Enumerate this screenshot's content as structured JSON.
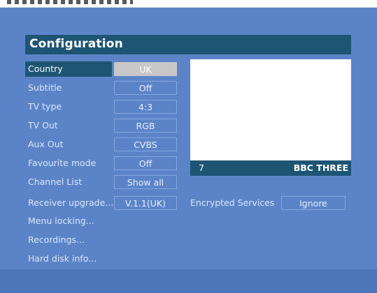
{
  "menu_title": "Configuration",
  "settings": [
    {
      "label": "Country",
      "value": "UK"
    },
    {
      "label": "Subtitle",
      "value": "Off"
    },
    {
      "label": "TV type",
      "value": "4:3"
    },
    {
      "label": "TV Out",
      "value": "RGB"
    },
    {
      "label": "Aux Out",
      "value": "CVBS"
    },
    {
      "label": "Favourite mode",
      "value": "Off"
    },
    {
      "label": "Channel List",
      "value": "Show all"
    },
    {
      "label": "Receiver upgrade...",
      "value": "V.1.1(UK)"
    }
  ],
  "menu_items": [
    {
      "label": "Menu locking..."
    },
    {
      "label": "Recordings..."
    },
    {
      "label": "Hard disk info..."
    }
  ],
  "preview": {
    "channel_number": "7",
    "channel_name": "BBC THREE"
  },
  "encrypted": {
    "label": "Encrypted Services",
    "value": "Ignore"
  },
  "colors": {
    "accent_bar": "#1e5573",
    "background": "#5b84c8",
    "selected_value": "#c7c7c7"
  }
}
